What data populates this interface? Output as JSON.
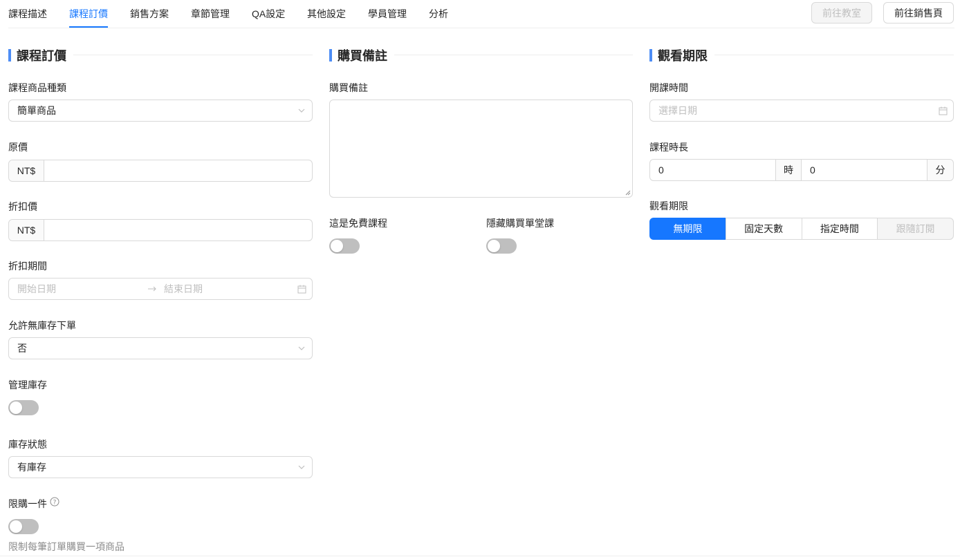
{
  "tabs": [
    {
      "label": "課程描述"
    },
    {
      "label": "課程訂價"
    },
    {
      "label": "銷售方案"
    },
    {
      "label": "章節管理"
    },
    {
      "label": "QA設定"
    },
    {
      "label": "其他設定"
    },
    {
      "label": "學員管理"
    },
    {
      "label": "分析"
    }
  ],
  "actions": {
    "go_classroom": "前往教室",
    "go_sales_page": "前往銷售頁"
  },
  "pricing": {
    "title": "課程訂價",
    "product_type_label": "課程商品種類",
    "product_type_value": "簡單商品",
    "original_price_label": "原價",
    "currency": "NT$",
    "original_price_value": "",
    "sale_price_label": "折扣價",
    "sale_price_value": "",
    "sale_period_label": "折扣期間",
    "start_placeholder": "開始日期",
    "end_placeholder": "結束日期",
    "backorders_label": "允許無庫存下單",
    "backorders_value": "否",
    "manage_stock_label": "管理庫存",
    "manage_stock_on": false,
    "stock_status_label": "庫存狀態",
    "stock_status_value": "有庫存",
    "limit_one_label": "限購一件",
    "limit_one_on": false,
    "limit_one_help": "限制每筆訂單購買一項商品"
  },
  "purchase_note": {
    "title": "購買備註",
    "note_label": "購買備註",
    "note_value": "",
    "free_course_label": "這是免費課程",
    "free_course_on": false,
    "hide_single_label": "隱藏購買單堂課",
    "hide_single_on": false
  },
  "access": {
    "title": "觀看期限",
    "start_time_label": "開課時間",
    "start_time_placeholder": "選擇日期",
    "duration_label": "課程時長",
    "hours_value": "0",
    "hours_unit": "時",
    "minutes_value": "0",
    "minutes_unit": "分",
    "limit_label": "觀看期限",
    "limit_options": [
      {
        "label": "無期限",
        "state": "selected"
      },
      {
        "label": "固定天數",
        "state": "normal"
      },
      {
        "label": "指定時間",
        "state": "normal"
      },
      {
        "label": "跟隨訂閱",
        "state": "disabled"
      }
    ]
  },
  "colors": {
    "accent": "#1677ff",
    "section_bar": "#4d8df5",
    "switch_off": "#bfbfbf"
  }
}
